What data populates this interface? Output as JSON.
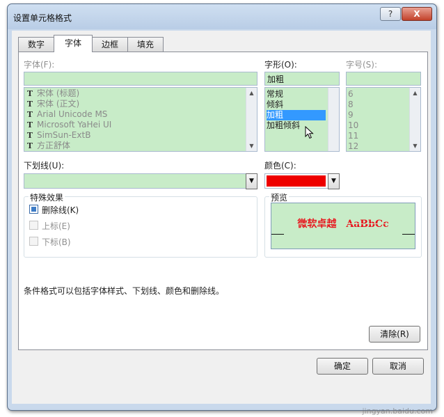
{
  "window": {
    "title": "设置单元格格式",
    "help_label": "?",
    "close_label": "X"
  },
  "tabs": [
    {
      "label": "数字"
    },
    {
      "label": "字体"
    },
    {
      "label": "边框"
    },
    {
      "label": "填充"
    }
  ],
  "font": {
    "label": "字体(F):",
    "value": "",
    "items": [
      {
        "icon": "truetype-icon",
        "label": "宋体 (标题)"
      },
      {
        "icon": "truetype-icon",
        "label": "宋体 (正文)"
      },
      {
        "icon": "truetype-icon",
        "label": "Arial Unicode MS"
      },
      {
        "icon": "truetype-icon",
        "label": "Microsoft YaHei UI"
      },
      {
        "icon": "truetype-icon",
        "label": "SimSun-ExtB"
      },
      {
        "icon": "truetype-icon",
        "label": "方正舒体"
      }
    ]
  },
  "style": {
    "label": "字形(O):",
    "value": "加粗",
    "items": [
      "常规",
      "倾斜",
      "加粗",
      "加粗倾斜"
    ],
    "selected": "加粗"
  },
  "size": {
    "label": "字号(S):",
    "value": "",
    "items": [
      "6",
      "8",
      "9",
      "10",
      "11",
      "12"
    ]
  },
  "underline": {
    "label": "下划线(U):",
    "value": ""
  },
  "color": {
    "label": "颜色(C):",
    "value": "#ee0000"
  },
  "effects": {
    "title": "特殊效果",
    "strikethrough": {
      "label": "删除线(K)",
      "checked": true
    },
    "superscript": {
      "label": "上标(E)",
      "checked": false
    },
    "subscript": {
      "label": "下标(B)",
      "checked": false
    }
  },
  "preview": {
    "title": "预览",
    "text": "微软卓越　AaBbCc",
    "text_color": "#e8131b"
  },
  "note": "条件格式可以包括字体样式、下划线、颜色和删除线。",
  "buttons": {
    "clear": "清除(R)",
    "ok": "确定",
    "cancel": "取消"
  },
  "watermark": "jingyan.baidu.com"
}
